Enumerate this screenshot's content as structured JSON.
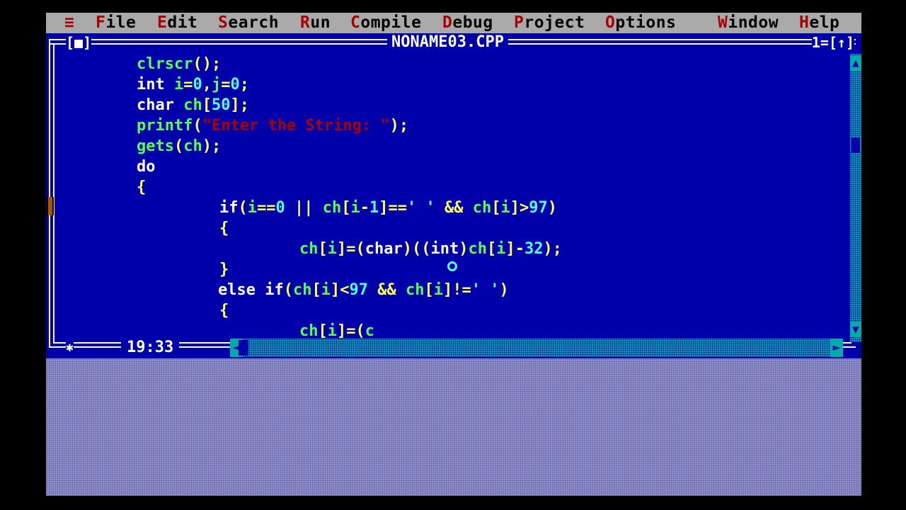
{
  "menu": {
    "system": "≡",
    "items": [
      {
        "hot": "F",
        "rest": "ile"
      },
      {
        "hot": "E",
        "rest": "dit"
      },
      {
        "hot": "S",
        "rest": "earch"
      },
      {
        "hot": "R",
        "rest": "un"
      },
      {
        "hot": "C",
        "rest": "ompile"
      },
      {
        "hot": "D",
        "rest": "ebug"
      },
      {
        "hot": "P",
        "rest": "roject"
      },
      {
        "hot": "O",
        "rest": "ptions"
      },
      {
        "hot": "W",
        "rest": "indow"
      },
      {
        "hot": "H",
        "rest": "elp"
      }
    ]
  },
  "window": {
    "close_box": "[■]",
    "title": "NONAME03.CPP",
    "number": "1=[↑]",
    "position": "19:33",
    "resize_glyph": "✱"
  },
  "code": [
    [
      "clrscr();"
    ],
    [
      "int i=0,j=0;"
    ],
    [
      "char ch[50];"
    ],
    [
      "printf(\"Enter the String: \");"
    ],
    [
      "gets(ch);"
    ],
    [
      "do"
    ],
    [
      "{"
    ],
    [
      "if(i==0 || ch[i-1]==' ' && ch[i]>97)"
    ],
    [
      "{"
    ],
    [
      "ch[i]=(char)((int)ch[i]-32);"
    ],
    [
      "}"
    ],
    [
      "else if(ch[i]<97 && ch[i]!=' ')"
    ],
    [
      "{"
    ],
    [
      "ch[i]=(c"
    ]
  ],
  "colors": {
    "editor_bg": "#0000aa",
    "menu_bg": "#aaaaaa",
    "hotkey": "#aa0000",
    "identifier": "#55ff55",
    "keyword": "#ffffff",
    "punctuation": "#ffff55",
    "number": "#55ffff",
    "string": "#aa0000",
    "scrollbar": "#00aaaa"
  },
  "icons": {
    "scroll_up": "▲",
    "scroll_down": "▼",
    "scroll_left": "◄",
    "scroll_right": "►"
  }
}
